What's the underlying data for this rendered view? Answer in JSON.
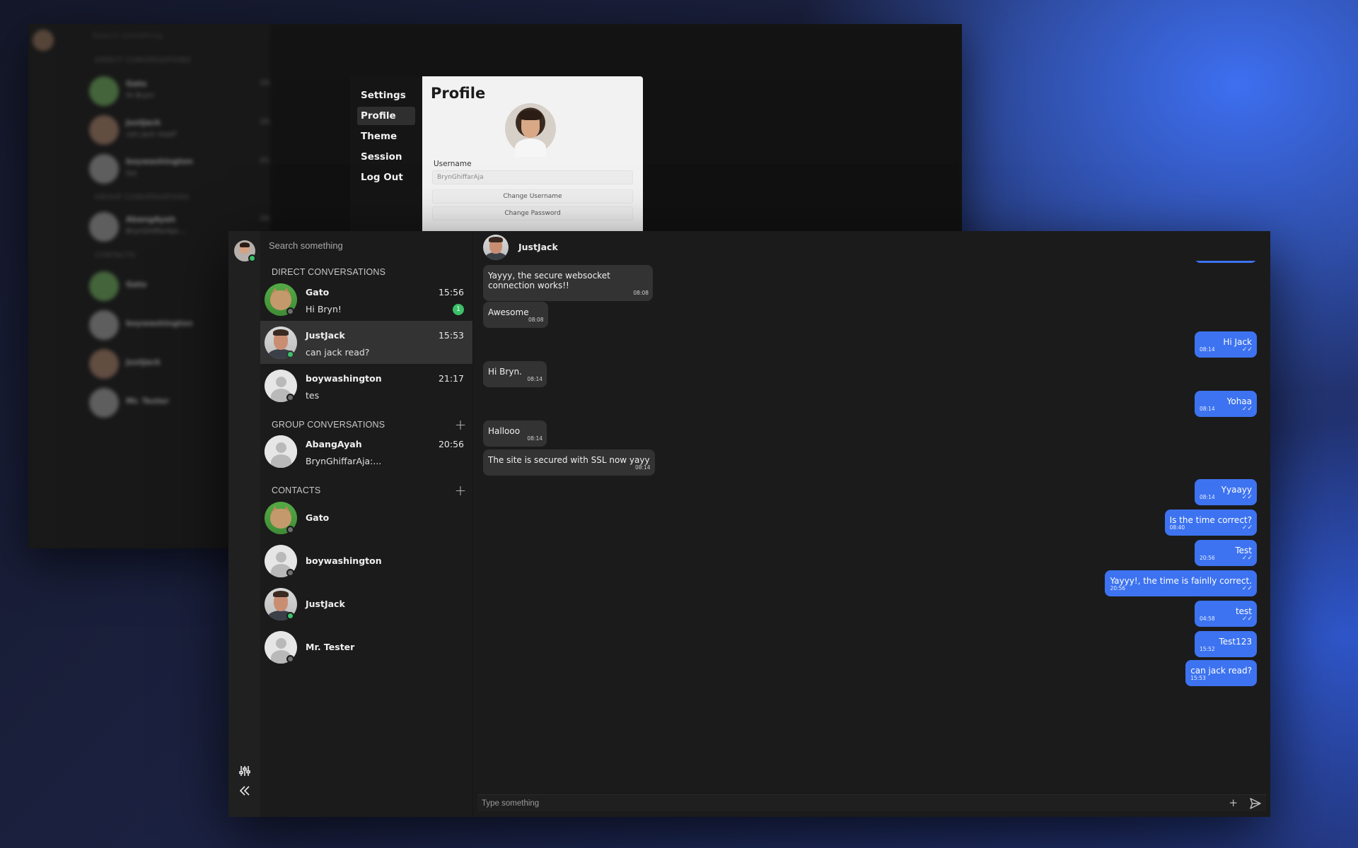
{
  "background_window": {
    "search_placeholder": "Search something",
    "sections": [
      "DIRECT CONVERSATIONS",
      "GROUP CONVERSATIONS",
      "CONTACTS"
    ],
    "rows": [
      {
        "name": "Gato",
        "message": "Hi Bryn!",
        "time": "15:56"
      },
      {
        "name": "JustJack",
        "message": "can jack read?",
        "time": "15:53"
      },
      {
        "name": "boywashington",
        "message": "tes",
        "time": "21:17"
      },
      {
        "name": "AbangAyah",
        "message": "BrynGhiffarAja:...",
        "time": "20:56"
      },
      {
        "name": "Gato"
      },
      {
        "name": "boywashington"
      },
      {
        "name": "JustJack"
      },
      {
        "name": "Mr. Tester"
      }
    ]
  },
  "settings": {
    "menu": [
      {
        "label": "Settings",
        "active": false
      },
      {
        "label": "Profile",
        "active": true
      },
      {
        "label": "Theme",
        "active": false
      },
      {
        "label": "Session",
        "active": false
      },
      {
        "label": "Log Out",
        "active": false
      }
    ],
    "profile": {
      "title": "Profile",
      "username_label": "Username",
      "username_value": "BrynGhiffarAja",
      "change_username": "Change Username",
      "change_password": "Change Password"
    }
  },
  "sidebar": {
    "search_placeholder": "Search something",
    "direct_title": "DIRECT CONVERSATIONS",
    "group_title": "GROUP CONVERSATIONS",
    "contacts_title": "CONTACTS",
    "direct": [
      {
        "name": "Gato",
        "message": "Hi Bryn!",
        "time": "15:56",
        "unread": "1",
        "status": "offline",
        "avatar": "gato"
      },
      {
        "name": "JustJack",
        "message": "can jack read?",
        "time": "15:53",
        "status": "online",
        "avatar": "jack",
        "active": true
      },
      {
        "name": "boywashington",
        "message": "tes",
        "time": "21:17",
        "status": "offline",
        "avatar": "default"
      }
    ],
    "groups": [
      {
        "name": "AbangAyah",
        "message": "BrynGhiffarAja:...",
        "time": "20:56",
        "avatar": "default"
      }
    ],
    "contacts": [
      {
        "name": "Gato",
        "status": "offline",
        "avatar": "gato"
      },
      {
        "name": "boywashington",
        "status": "offline",
        "avatar": "default"
      },
      {
        "name": "JustJack",
        "status": "online",
        "avatar": "jack"
      },
      {
        "name": "Mr. Tester",
        "status": "offline",
        "avatar": "default"
      }
    ]
  },
  "chat": {
    "contact_name": "JustJack",
    "composer_placeholder": "Type something",
    "messages": [
      {
        "dir": "in",
        "text": "Yayyy, the secure websocket connection works!!",
        "time": "08:08"
      },
      {
        "dir": "in",
        "text": "Awesome",
        "time": "08:08"
      },
      {
        "dir": "out",
        "text": "Hi Jack",
        "time": "08:14"
      },
      {
        "dir": "in",
        "text": "Hi Bryn.",
        "time": "08:14"
      },
      {
        "dir": "out",
        "text": "Yohaa",
        "time": "08:14"
      },
      {
        "dir": "in",
        "text": "Hallooo",
        "time": "08:14"
      },
      {
        "dir": "in",
        "text": "The site is secured with SSL now yayy",
        "time": "08:14"
      },
      {
        "dir": "out",
        "text": "Yyaayy",
        "time": "08:14"
      },
      {
        "dir": "out",
        "text": "Is the time correct?",
        "time": "08:40"
      },
      {
        "dir": "out",
        "text": "Test",
        "time": "20:56"
      },
      {
        "dir": "out",
        "text": "Yayyy!, the time is fainlly correct.",
        "time": "20:56"
      },
      {
        "dir": "out",
        "text": "test",
        "time": "04:58"
      },
      {
        "dir": "out",
        "text": "Test123",
        "time": "15:52"
      },
      {
        "dir": "out",
        "text": "can jack read?",
        "time": "15:53"
      }
    ]
  },
  "colors": {
    "accent": "#3d73f0",
    "online": "#3cc06b",
    "panel": "#1b1b1b",
    "bubble_in": "#333333"
  },
  "icons": [
    "filter-sliders-icon",
    "collapse-double-chevron-icon",
    "plus-icon",
    "send-icon",
    "check-double-icon"
  ]
}
